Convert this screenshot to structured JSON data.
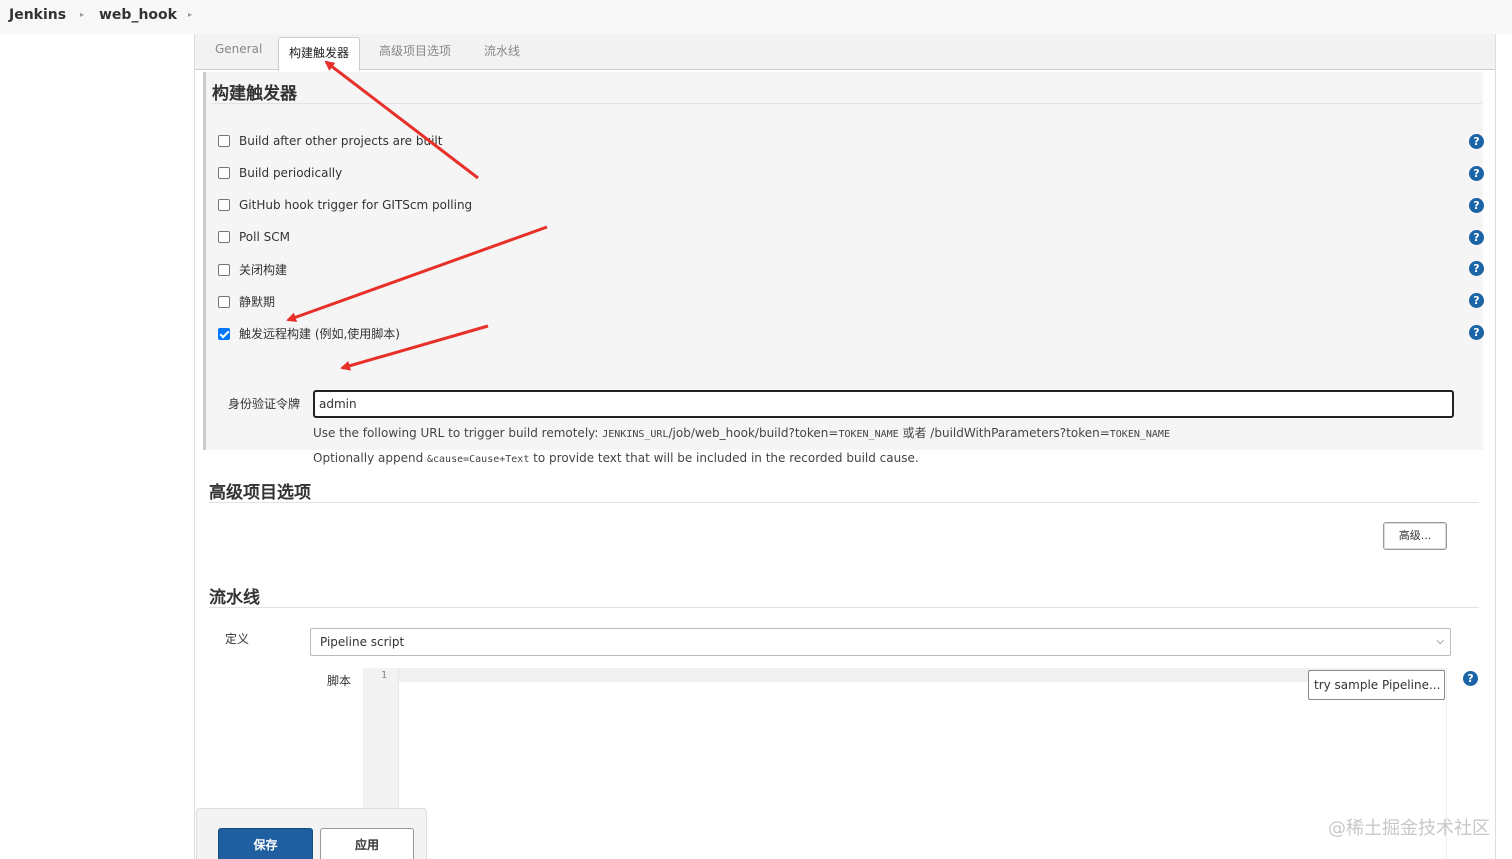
{
  "breadcrumb": {
    "root": "Jenkins",
    "job": "web_hook",
    "separator": "▸"
  },
  "tabs": [
    {
      "label": "General",
      "active": false
    },
    {
      "label": "构建触发器",
      "active": true
    },
    {
      "label": "高级项目选项",
      "active": false
    },
    {
      "label": "流水线",
      "active": false
    }
  ],
  "triggers": {
    "title": "构建触发器",
    "options": [
      {
        "label": "Build after other projects are built",
        "checked": false
      },
      {
        "label": "Build periodically",
        "checked": false
      },
      {
        "label": "GitHub hook trigger for GITScm polling",
        "checked": false
      },
      {
        "label": "Poll SCM",
        "checked": false
      },
      {
        "label": "关闭构建",
        "checked": false
      },
      {
        "label": "静默期",
        "checked": false
      },
      {
        "label": "触发远程构建 (例如,使用脚本)",
        "checked": true
      }
    ],
    "token_label": "身份验证令牌",
    "token_value": "admin",
    "hint_url_prefix": "Use the following URL to trigger build remotely: ",
    "hint_url_code": "JENKINS_URL",
    "hint_url_path": "/job/web_hook/build?token=",
    "hint_url_token": "TOKEN_NAME",
    "hint_url_or": " 或者 /buildWithParameters?token=",
    "hint_url_token2": "TOKEN_NAME",
    "hint_cause_prefix": "Optionally append ",
    "hint_cause_code": "&cause=Cause+Text",
    "hint_cause_suffix": " to provide text that will be included in the recorded build cause.",
    "help_symbol": "?"
  },
  "advanced": {
    "title": "高级项目选项",
    "button_label": "高级..."
  },
  "pipeline": {
    "title": "流水线",
    "definition_label": "定义",
    "definition_value": "Pipeline script",
    "script_label": "脚本",
    "line_number": "1",
    "sample_select": "try sample Pipeline..."
  },
  "actions": {
    "save": "保存",
    "apply": "应用"
  },
  "watermark": "@稀土掘金技术社区",
  "colors": {
    "accent": "#1f5fa0",
    "help_icon": "#1c64a8",
    "annotation_arrow": "#e8302a"
  }
}
